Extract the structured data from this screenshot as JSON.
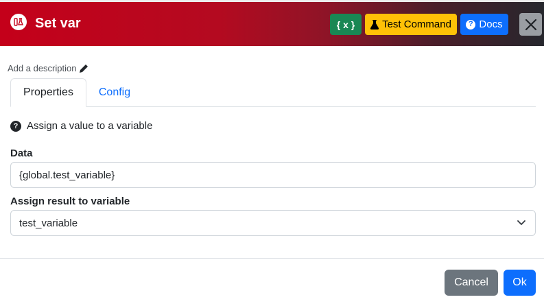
{
  "header": {
    "title": "Set var",
    "icon": "flask-bottles-icon",
    "variables_button": "{ x }",
    "test_command_button": "Test Command",
    "docs_button": "Docs",
    "close_icon": "close-icon",
    "colors": {
      "gradient_start": "#c4001a",
      "gradient_end": "#26272d",
      "green": "#198754",
      "yellow": "#ffc107",
      "blue": "#0d6efd"
    }
  },
  "description": {
    "placeholder": "Add a description",
    "icon": "pencil-icon"
  },
  "tabs": [
    {
      "label": "Properties",
      "active": true
    },
    {
      "label": "Config",
      "active": false
    }
  ],
  "help": {
    "icon": "question-circle-icon",
    "text": "Assign a value to a variable"
  },
  "form": {
    "data_label": "Data",
    "data_value": "{global.test_variable}",
    "assign_label": "Assign result to variable",
    "assign_value": "test_variable",
    "assign_icon": "chevron-down-icon"
  },
  "footer": {
    "cancel": "Cancel",
    "ok": "Ok"
  }
}
